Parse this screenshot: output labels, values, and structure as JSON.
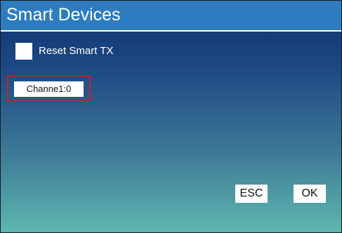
{
  "window": {
    "title": "Smart Devices"
  },
  "options": {
    "reset_smart_tx_label": "Reset Smart TX",
    "reset_smart_tx_checked": false
  },
  "channel": {
    "value": "Channe1:0"
  },
  "buttons": {
    "esc_label": "ESC",
    "ok_label": "OK"
  },
  "colors": {
    "title_bar": "#2d7cc0",
    "background_top": "#112f6d",
    "background_bottom": "#5eb7ae",
    "focus_border": "#c8202a"
  }
}
